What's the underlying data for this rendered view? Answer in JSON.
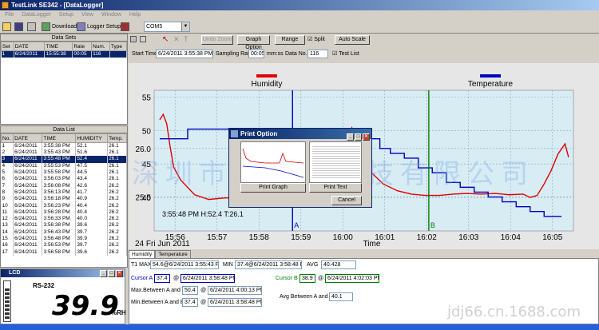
{
  "window": {
    "title": "TestLink SE342 - [DataLogger]"
  },
  "menu": [
    "File",
    "DataLogger",
    "Setup",
    "View",
    "Window",
    "Help"
  ],
  "toolbar": {
    "download_label": "Download",
    "logger_setup_label": "Logger Setup",
    "com_port": "COM5"
  },
  "chart_toolbar": {
    "undo_zoom": "Undo Zoom",
    "graph_option": "Graph Option",
    "range": "Range",
    "split": "Split",
    "auto_scale": "Auto Scale"
  },
  "params": {
    "start_time_label": "Start Time",
    "start_time": "6/24/2011 3:55:38 PM",
    "sampling_rate_label": "Sampling Rate",
    "sampling_rate": "00:05",
    "sampling_unit": "mm:ss",
    "data_no_label": "Data No.",
    "data_no": "116",
    "test_list_label": "Test List"
  },
  "datasets": {
    "header": "Data Sets",
    "columns": [
      "Set",
      "DATE",
      "TIME",
      "Rate",
      "Num.",
      "Type"
    ],
    "rows": [
      [
        "1",
        "6/24/2011",
        "15:55:38",
        "00:05",
        "116",
        ""
      ]
    ]
  },
  "datalist": {
    "header": "Data List",
    "columns": [
      "No.",
      "DATE",
      "TIME",
      "HUMIDITY",
      "Temp."
    ],
    "rows": [
      [
        "1",
        "6/24/2011",
        "3:55:38 PM",
        "52.1",
        "26.1"
      ],
      [
        "2",
        "6/24/2011",
        "3:55:43 PM",
        "51.6",
        "26.1"
      ],
      [
        "3",
        "6/24/2011",
        "3:55:48 PM",
        "52.4",
        "26.1"
      ],
      [
        "4",
        "6/24/2011",
        "3:55:53 PM",
        "47.5",
        "26.1"
      ],
      [
        "5",
        "6/24/2011",
        "3:55:58 PM",
        "44.5",
        "26.1"
      ],
      [
        "6",
        "6/24/2011",
        "3:56:03 PM",
        "43.4",
        "26.1"
      ],
      [
        "7",
        "6/24/2011",
        "3:56:08 PM",
        "42.6",
        "26.2"
      ],
      [
        "8",
        "6/24/2011",
        "3:56:13 PM",
        "41.7",
        "26.2"
      ],
      [
        "9",
        "6/24/2011",
        "3:56:18 PM",
        "40.9",
        "26.2"
      ],
      [
        "10",
        "6/24/2011",
        "3:56:23 PM",
        "40.4",
        "26.2"
      ],
      [
        "11",
        "6/24/2011",
        "3:56:28 PM",
        "40.4",
        "26.2"
      ],
      [
        "12",
        "6/24/2011",
        "3:56:33 PM",
        "40.0",
        "26.2"
      ],
      [
        "13",
        "6/24/2011",
        "3:56:38 PM",
        "39.6",
        "26.2"
      ],
      [
        "14",
        "6/24/2011",
        "3:56:43 PM",
        "39.7",
        "26.2"
      ],
      [
        "15",
        "6/24/2011",
        "3:56:48 PM",
        "39.9",
        "26.2"
      ],
      [
        "16",
        "6/24/2011",
        "3:56:53 PM",
        "39.7",
        "26.2"
      ],
      [
        "17",
        "6/24/2011",
        "3:56:58 PM",
        "39.6",
        "26.2"
      ]
    ],
    "selected_index": 2
  },
  "lcd": {
    "title": "LCD",
    "mode": "RS-232",
    "value": "39.9",
    "unit": "%RH"
  },
  "chart_data": {
    "type": "line",
    "title": "",
    "legend": [
      "Humidity",
      "Temperature"
    ],
    "legend_colors": [
      "#e00000",
      "#0000c0"
    ],
    "xlabel": "Time",
    "date_label": "24 Fri Jun 2011",
    "x_ticks": [
      "15:56",
      "15:57",
      "15:58",
      "15:59",
      "16:00",
      "16:01",
      "16:02",
      "16:03",
      "16:04",
      "16:05"
    ],
    "y_ticks_humidity": [
      "55",
      "50",
      "45",
      "40"
    ],
    "y_ticks_temperature": [
      "26.0",
      "25.5"
    ],
    "cursor_label": "3:55:48 PM H:52.4 T:26.1",
    "cursor_a_label": "A",
    "cursor_b_label": "B",
    "series": [
      {
        "name": "Humidity",
        "color": "#e00000",
        "x": [
          "15:55:38",
          "15:55:43",
          "15:55:48",
          "15:55:53",
          "15:55:58",
          "15:56:08",
          "15:56:28",
          "15:56:48",
          "15:57:08",
          "15:57:28",
          "15:57:48",
          "15:58:08",
          "15:58:28",
          "15:58:48",
          "15:59:08",
          "15:59:28",
          "15:59:48",
          "16:00:03",
          "16:00:13",
          "16:00:23",
          "16:00:38",
          "16:00:58",
          "16:01:18",
          "16:01:38",
          "16:01:58",
          "16:02:18",
          "16:02:38",
          "16:02:58",
          "16:03:18",
          "16:03:38",
          "16:03:58",
          "16:04:18",
          "16:04:28",
          "16:04:38",
          "16:04:48",
          "16:04:58",
          "16:05:08",
          "16:05:18",
          "16:05:23"
        ],
        "values": [
          51.6,
          52.4,
          51.0,
          47.5,
          44.5,
          42.6,
          40.4,
          39.7,
          39.9,
          40.0,
          39.8,
          40.0,
          39.9,
          40.2,
          40.5,
          40.5,
          40.8,
          44.0,
          50.4,
          48.5,
          44.0,
          42.0,
          41.0,
          40.5,
          40.3,
          40.3,
          40.5,
          40.6,
          40.5,
          40.6,
          40.4,
          40.5,
          40.0,
          40.3,
          42.0,
          44.0,
          46.5,
          48.0,
          46.0
        ]
      },
      {
        "name": "Temperature",
        "color": "#0000c0",
        "x": [
          "15:55:38",
          "15:56:18",
          "15:59:48",
          "16:00:53",
          "16:01:08",
          "16:01:28",
          "16:01:48",
          "16:02:08",
          "16:02:28",
          "16:02:48",
          "16:03:08",
          "16:03:28",
          "16:03:48",
          "16:04:08",
          "16:04:28",
          "16:04:48",
          "16:05:13"
        ],
        "values": [
          26.1,
          26.2,
          26.1,
          26.0,
          25.95,
          25.9,
          25.8,
          25.75,
          25.65,
          25.6,
          25.55,
          25.5,
          25.45,
          25.4,
          25.35,
          25.3,
          25.3
        ]
      }
    ]
  },
  "print_dialog": {
    "title": "Print Option",
    "graph_button": "Print Graph",
    "text_button": "Print Text",
    "cancel_button": "Cancel"
  },
  "stats": {
    "tab_humidity": "Humidity",
    "tab_temperature": "Temperature",
    "t1max_label": "T1 MAX",
    "t1max": "54.6@6/24/2011 3:55:43 PM",
    "min_label": "MIN",
    "min": "37.4@6/24/2011 3:58:48 PM",
    "avg_label": "AVG",
    "avg": "40.428",
    "cursor_a_label": "Cursor A",
    "cursor_a_value": "37.4",
    "cursor_a_time": "6/24/2011 3:58:48 PM",
    "cursor_b_label": "Cursor B",
    "cursor_b_value": "38.9",
    "cursor_b_time": "6/24/2011 4:02:03 PM",
    "max_ab_label": "Max.Between A and B",
    "max_ab_value": "50.4",
    "max_ab_time": "6/24/2011 4:00:13 PM",
    "min_ab_label": "Min.Between A and B",
    "min_ab_value": "37.4",
    "min_ab_time": "6/24/2011 3:58:48 PM",
    "avg_ab_label": "Avg Between A and B",
    "avg_ab_value": "40.1",
    "at": "@"
  },
  "watermark": {
    "main": "深圳市金瑞达科技有限公司",
    "url": "jdj66.cn.1688.com"
  }
}
